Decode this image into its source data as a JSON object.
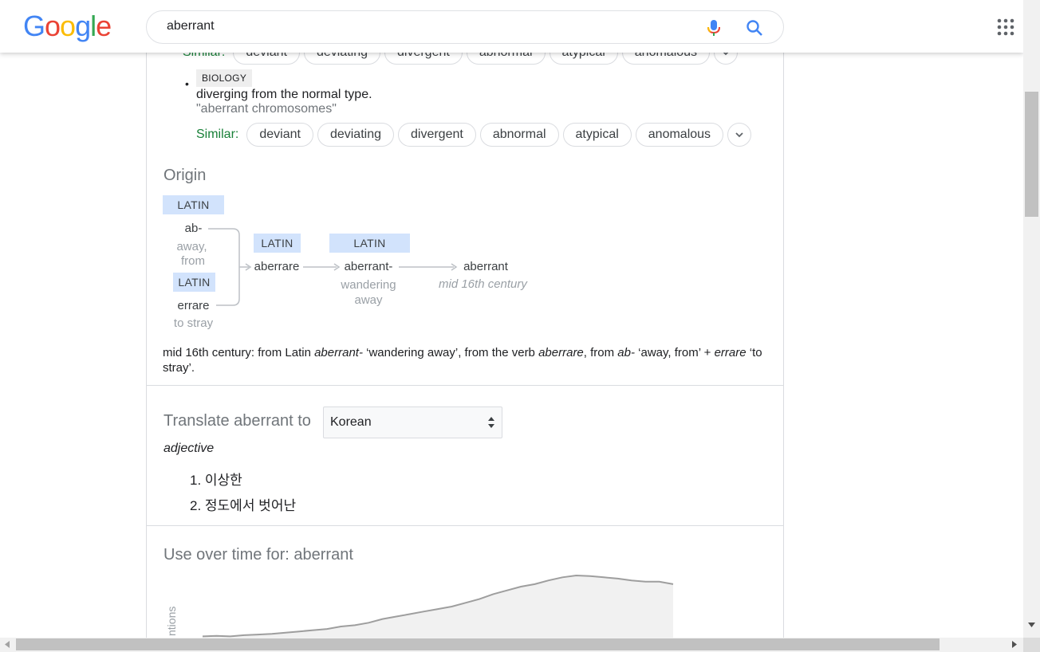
{
  "header": {
    "logo": [
      "G",
      "o",
      "o",
      "g",
      "l",
      "e"
    ],
    "logo_colors": [
      "#4285f4",
      "#ea4335",
      "#fbbc05",
      "#4285f4",
      "#34a853",
      "#ea4335"
    ],
    "search_value": "aberrant"
  },
  "senses": [
    {
      "similar_label": "Similar:",
      "chips": [
        "deviant",
        "deviating",
        "divergent",
        "abnormal",
        "atypical",
        "anomalous"
      ]
    },
    {
      "domain": "BIOLOGY",
      "definition": "diverging from the normal type.",
      "example": "\"aberrant chromosomes\"",
      "similar_label": "Similar:",
      "chips": [
        "deviant",
        "deviating",
        "divergent",
        "abnormal",
        "atypical",
        "anomalous"
      ]
    }
  ],
  "origin": {
    "title": "Origin",
    "etymology": {
      "lang_latin": "LATIN",
      "ab": "ab-",
      "ab_gloss_1": "away,",
      "ab_gloss_2": "from",
      "errare": "errare",
      "errare_gloss": "to stray",
      "aberrare": "aberrare",
      "aberrant_stem": "aberrant-",
      "stem_gloss_1": "wandering",
      "stem_gloss_2": "away",
      "aberrant": "aberrant",
      "date": "mid 16th century"
    },
    "text_parts": [
      "mid 16th century: from Latin ",
      "aberrant-",
      " ‘wandering away’, from the verb ",
      "aberrare",
      ", from ",
      "ab-",
      " ‘away, from’ + ",
      "errare",
      " ‘to stray’."
    ]
  },
  "translate": {
    "label": "Translate aberrant to",
    "selected_language": "Korean",
    "pos": "adjective",
    "items": [
      "1. 이상한",
      "2. 정도에서 벗어난"
    ]
  },
  "usage": {
    "title": "Use over time for: aberrant",
    "ylabel": "ntions"
  },
  "chart_data": {
    "type": "area",
    "title": "Use over time for: aberrant",
    "ylabel": "ntions",
    "values": [
      0.02,
      0.03,
      0.02,
      0.04,
      0.05,
      0.06,
      0.08,
      0.1,
      0.12,
      0.14,
      0.18,
      0.2,
      0.24,
      0.3,
      0.34,
      0.38,
      0.42,
      0.46,
      0.5,
      0.56,
      0.62,
      0.7,
      0.76,
      0.82,
      0.86,
      0.92,
      0.97,
      1.0,
      0.99,
      0.97,
      0.95,
      0.92,
      0.9,
      0.9,
      0.86
    ]
  }
}
